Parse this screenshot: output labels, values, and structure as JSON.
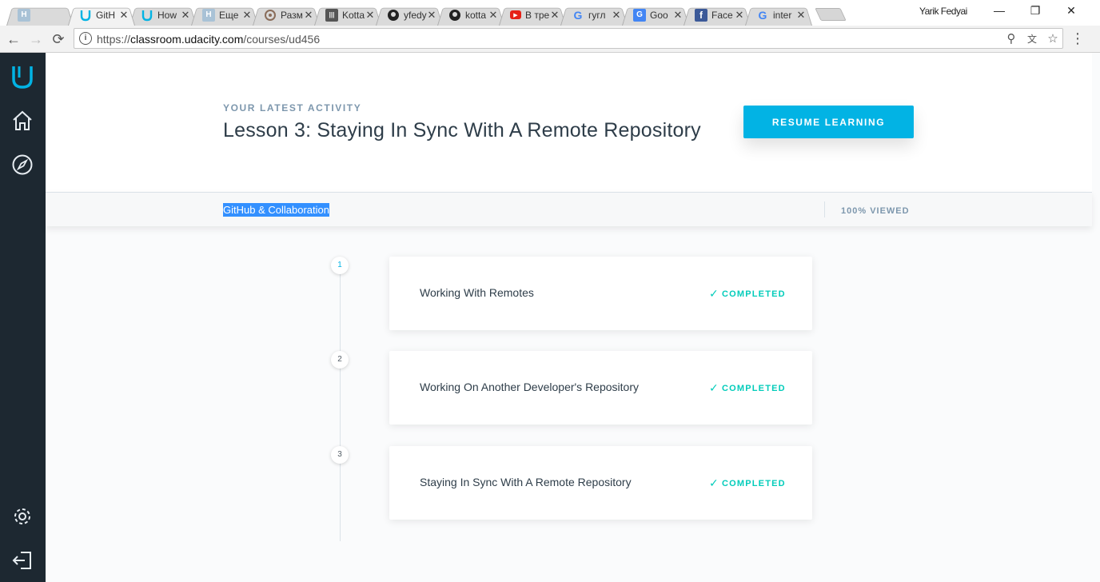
{
  "browser": {
    "tabs": [
      {
        "label": "",
        "icon": "h-favicon-icon",
        "active": false
      },
      {
        "label": "GitH",
        "icon": "udacity-favicon-icon",
        "active": true
      },
      {
        "label": "How",
        "icon": "udacity-favicon-icon",
        "active": false
      },
      {
        "label": "Еще",
        "icon": "h-favicon-icon",
        "active": false
      },
      {
        "label": "Разм",
        "icon": "circle-favicon-icon",
        "active": false
      },
      {
        "label": "Kotta",
        "icon": "kotta-favicon-icon",
        "active": false
      },
      {
        "label": "yfedy",
        "icon": "github-favicon-icon",
        "active": false
      },
      {
        "label": "kotta",
        "icon": "github-favicon-icon",
        "active": false
      },
      {
        "label": "В тре",
        "icon": "youtube-favicon-icon",
        "active": false
      },
      {
        "label": "гугл",
        "icon": "google-favicon-icon",
        "active": false
      },
      {
        "label": "Goo",
        "icon": "google-translate-favicon-icon",
        "active": false
      },
      {
        "label": "Face",
        "icon": "facebook-favicon-icon",
        "active": false
      },
      {
        "label": "inter",
        "icon": "google-favicon-icon",
        "active": false
      }
    ],
    "profile_name": "Yarik Fedyai",
    "url_prefix": "https://",
    "url_domain": "classroom.udacity.com",
    "url_path": "/courses/ud456"
  },
  "header": {
    "latest_label": "YOUR LATEST ACTIVITY",
    "lesson_title": "Lesson 3: Staying In Sync With A Remote Repository",
    "resume_label": "RESUME LEARNING"
  },
  "course": {
    "name": "GitHub & Collaboration",
    "viewed": "100% VIEWED"
  },
  "lessons": [
    {
      "number": "1",
      "title": "Working With Remotes",
      "status": "COMPLETED"
    },
    {
      "number": "2",
      "title": "Working On Another Developer's Repository",
      "status": "COMPLETED"
    },
    {
      "number": "3",
      "title": "Staying In Sync With A Remote Repository",
      "status": "COMPLETED"
    }
  ],
  "colors": {
    "accent": "#02b3e4",
    "rail": "#1d2831",
    "completed": "#02ccba",
    "title_text": "#2e3d49",
    "selection": "#3390ff"
  }
}
